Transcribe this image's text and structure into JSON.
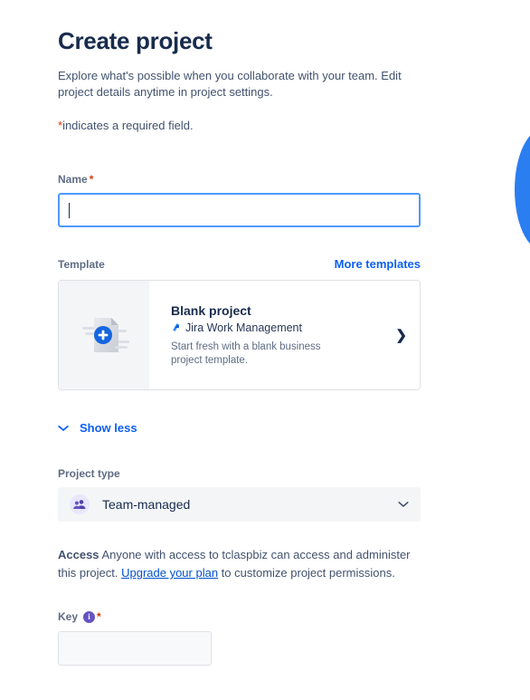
{
  "header": {
    "title": "Create project",
    "intro": "Explore what's possible when you collaborate with your team. Edit project details anytime in project settings.",
    "required_note": "indicates a required field.",
    "required_marker": "*"
  },
  "name_field": {
    "label": "Name",
    "required_marker": "*",
    "value": "",
    "placeholder": ""
  },
  "template_section": {
    "label": "Template",
    "more_templates_link": "More templates",
    "card": {
      "title": "Blank project",
      "product": "Jira Work Management",
      "product_icon": "jira-logo-icon",
      "description": "Start fresh with a blank business project template.",
      "thumbnail_icon": "blank-document-plus-icon",
      "chevron": "❯"
    }
  },
  "show_less": {
    "label": "Show less",
    "icon": "chevron-down-icon"
  },
  "project_type": {
    "label": "Project type",
    "selected": "Team-managed",
    "icon": "team-people-icon",
    "chevron": "chevron-down-icon"
  },
  "access": {
    "title": "Access",
    "text_before_link": " Anyone with access to tclaspbiz can access and administer this project. ",
    "link": "Upgrade your plan",
    "text_after_link": " to customize project permissions."
  },
  "key_field": {
    "label": "Key",
    "info_icon": "i",
    "required_marker": "*",
    "value": "",
    "placeholder": ""
  },
  "colors": {
    "accent_blue": "#0c5ff3",
    "link_blue": "#0052cc",
    "focus_border": "#4c9aff",
    "required_red": "#de350b",
    "text_dark": "#172b4d",
    "text_muted": "#5e6c84",
    "purple": "#6554c0",
    "decorative_blue": "#2a7ef0"
  }
}
